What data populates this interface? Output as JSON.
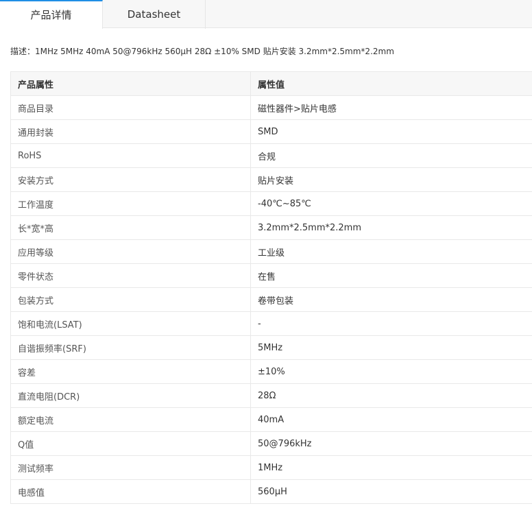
{
  "tabs": [
    {
      "label": "产品详情",
      "active": true
    },
    {
      "label": "Datasheet",
      "active": false
    }
  ],
  "description": "描述：1MHz 5MHz 40mA 50@796kHz 560μH 28Ω ±10% SMD 贴片安装 3.2mm*2.5mm*2.2mm",
  "table": {
    "headers": [
      "产品属性",
      "属性值"
    ],
    "rows": [
      {
        "k": "商品目录",
        "v": "磁性器件>贴片电感"
      },
      {
        "k": "通用封装",
        "v": "SMD"
      },
      {
        "k": "RoHS",
        "v": "合规"
      },
      {
        "k": "安装方式",
        "v": "贴片安装"
      },
      {
        "k": "工作温度",
        "v": "-40℃~85℃"
      },
      {
        "k": "长*宽*高",
        "v": "3.2mm*2.5mm*2.2mm"
      },
      {
        "k": "应用等级",
        "v": "工业级"
      },
      {
        "k": "零件状态",
        "v": "在售"
      },
      {
        "k": "包装方式",
        "v": "卷带包装"
      },
      {
        "k": "饱和电流(LSAT)",
        "v": "-"
      },
      {
        "k": "自谐振频率(SRF)",
        "v": "5MHz"
      },
      {
        "k": "容差",
        "v": "±10%"
      },
      {
        "k": "直流电阻(DCR)",
        "v": "28Ω"
      },
      {
        "k": "额定电流",
        "v": "40mA"
      },
      {
        "k": "Q值",
        "v": "50@796kHz"
      },
      {
        "k": "测试频率",
        "v": "1MHz"
      },
      {
        "k": "电感值",
        "v": "560μH"
      }
    ]
  },
  "colors": {
    "active_tab_accent": "#1f8fe5",
    "header_bg": "#f7f7f7",
    "border": "#e8e8e8"
  }
}
